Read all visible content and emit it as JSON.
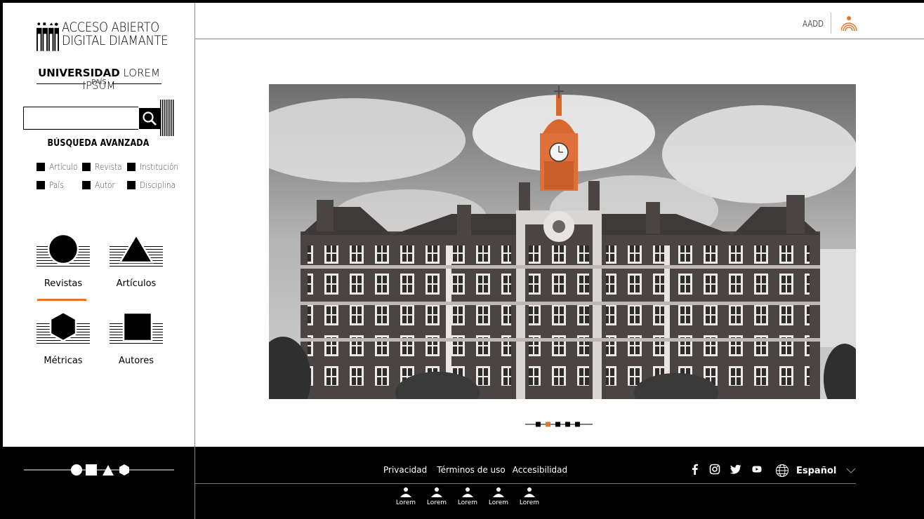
{
  "brand": {
    "logo_line1": "ACCESO ABIERTO",
    "logo_line2": "DIGITAL DIAMANTE",
    "university_bold": "UNIVERSIDAD",
    "university_rest": " LOREM IPSUM",
    "country": "PAÍS"
  },
  "search": {
    "value": "",
    "placeholder": "",
    "advanced_label": "BÚSQUEDA AVANZADA",
    "filters": [
      "Artículo",
      "Revista",
      "Institución",
      "País",
      "Autor",
      "Disciplina"
    ]
  },
  "nav": {
    "items": [
      {
        "label": "Revistas",
        "icon": "circle-icon",
        "active": true
      },
      {
        "label": "Artículos",
        "icon": "triangle-icon",
        "active": false
      },
      {
        "label": "Métricas",
        "icon": "hexagon-icon",
        "active": false
      },
      {
        "label": "Autores",
        "icon": "square-icon",
        "active": false
      }
    ]
  },
  "header": {
    "aadd_label": "AADD",
    "user_icon": "user-signal-icon"
  },
  "carousel": {
    "slide_count": 5,
    "active_index": 1
  },
  "footer": {
    "links": [
      "Privacidad",
      "Términos de uso",
      "Accesibilidad"
    ],
    "social": [
      "facebook-icon",
      "instagram-icon",
      "twitter-icon",
      "youtube-icon"
    ],
    "language": "Español",
    "people": [
      "Lorem",
      "Lorem",
      "Lorem",
      "Lorem",
      "Lorem"
    ]
  },
  "colors": {
    "accent": "#e8742c",
    "primary": "#000000",
    "background": "#ffffff"
  }
}
